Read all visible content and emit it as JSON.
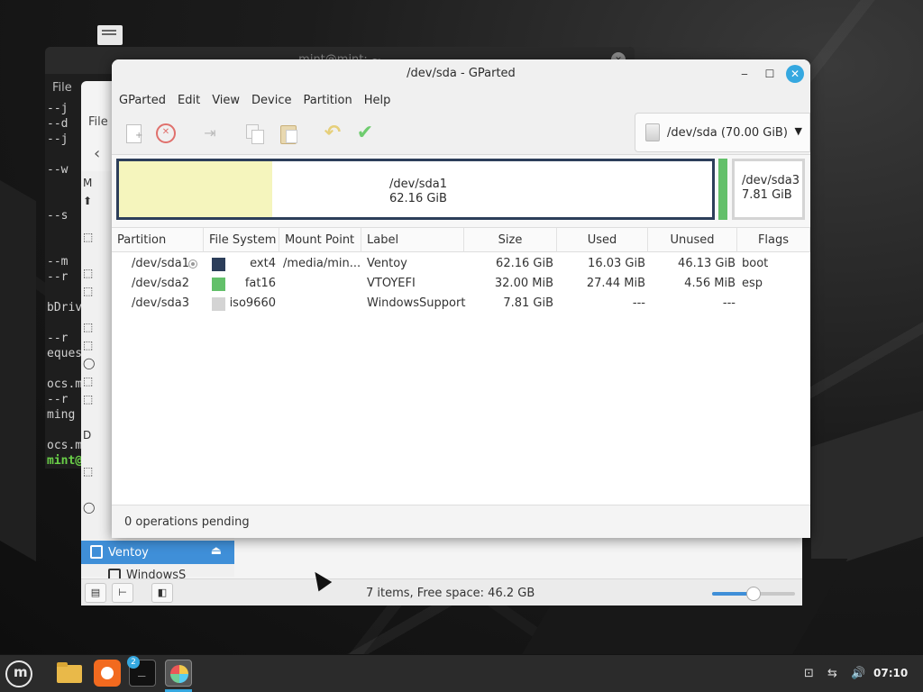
{
  "terminal": {
    "title": "mint@mint: ~",
    "menu_file": "File",
    "lines": [
      "--j",
      "--d",
      "--j",
      "",
      "--w",
      "",
      "",
      "--s",
      "",
      "",
      "--m",
      "--r",
      "",
      "bDriv",
      "",
      "--r",
      "eques",
      "",
      "ocs.m",
      "--r",
      "ming",
      "",
      "ocs.m"
    ],
    "prompt": "mint@"
  },
  "files": {
    "menu_file": "File",
    "sidebar_glyphs": [
      "M",
      "⬆",
      "",
      "⬚",
      "",
      "⬚",
      "⬚",
      "",
      "⬚",
      "⬚",
      "◯",
      "⬚",
      "⬚",
      "",
      "D",
      "",
      "⬚",
      "",
      "◯"
    ],
    "device_ventoy": "Ventoy",
    "device_windows": "WindowsS",
    "status_text": "7 items, Free space: 46.2 GB",
    "zoom_level": 0.5
  },
  "gparted": {
    "title": "/dev/sda - GParted",
    "menu": [
      "GParted",
      "Edit",
      "View",
      "Device",
      "Partition",
      "Help"
    ],
    "toolbar_icons": [
      "new-partition-icon",
      "delete-icon",
      "resize-move-icon",
      "copy-icon",
      "paste-icon",
      "undo-icon",
      "apply-icon"
    ],
    "device_selector": "/dev/sda  (70.00 GiB)",
    "map": {
      "sda1_name": "/dev/sda1",
      "sda1_size": "62.16 GiB",
      "sda1_used_fraction": 0.258,
      "sda3_name": "/dev/sda3",
      "sda3_size": "7.81 GiB"
    },
    "columns": [
      "Partition",
      "File System",
      "Mount Point",
      "Label",
      "Size",
      "Used",
      "Unused",
      "Flags"
    ],
    "rows": [
      {
        "partition": "/dev/sda1",
        "fs": "ext4",
        "fs_color": "#2c3e5a",
        "mount": "/media/min...",
        "label": "Ventoy",
        "size": "62.16 GiB",
        "used": "16.03 GiB",
        "unused": "46.13 GiB",
        "flags": "boot",
        "mounted": true
      },
      {
        "partition": "/dev/sda2",
        "fs": "fat16",
        "fs_color": "#63c06a",
        "mount": "",
        "label": "VTOYEFI",
        "size": "32.00 MiB",
        "used": "27.44 MiB",
        "unused": "4.56 MiB",
        "flags": "esp",
        "mounted": false
      },
      {
        "partition": "/dev/sda3",
        "fs": "iso9660",
        "fs_color": "#d4d4d4",
        "mount": "",
        "label": "WindowsSupport",
        "size": "7.81 GiB",
        "used": "---",
        "unused": "---",
        "flags": "",
        "mounted": false
      }
    ],
    "status": "0 operations pending"
  },
  "taskbar": {
    "terminal_badge": "2",
    "clock": "07:10"
  }
}
